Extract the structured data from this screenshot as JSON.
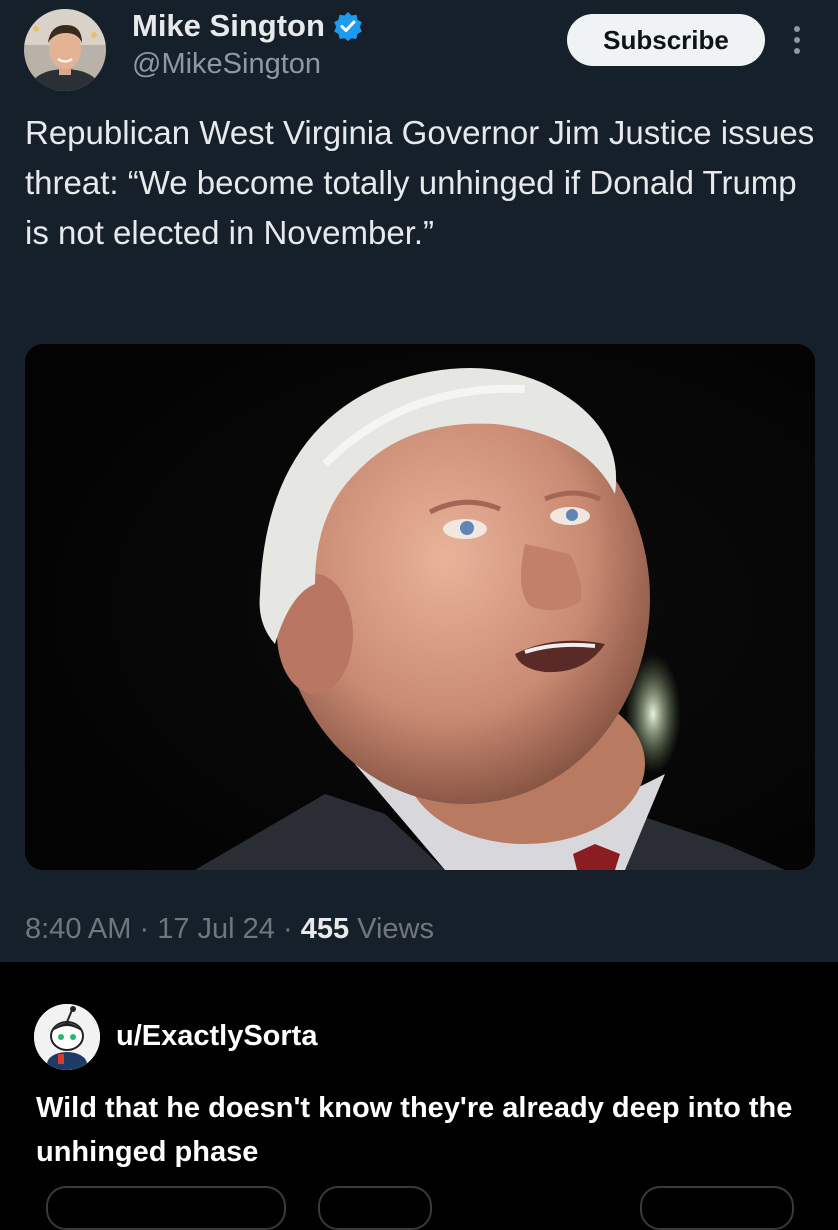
{
  "tweet": {
    "author_name": "Mike Sington",
    "handle": "@MikeSington",
    "subscribe_label": "Subscribe",
    "text": "Republican West Virginia Governor Jim Justice issues threat: “We become totally unhinged if Donald Trump is not elected in November.”",
    "time": "8:40 AM",
    "separator": "·",
    "date": "17 Jul 24",
    "views_count": "455",
    "views_label": "Views"
  },
  "comment": {
    "username": "u/ExactlySorta",
    "text": "Wild that he doesn't know they're already deep into the unhinged phase"
  },
  "colors": {
    "tweet_background": "#15202b",
    "page_background": "#000000",
    "verified_badge": "#1d9bf0",
    "secondary_text": "#71767b"
  }
}
